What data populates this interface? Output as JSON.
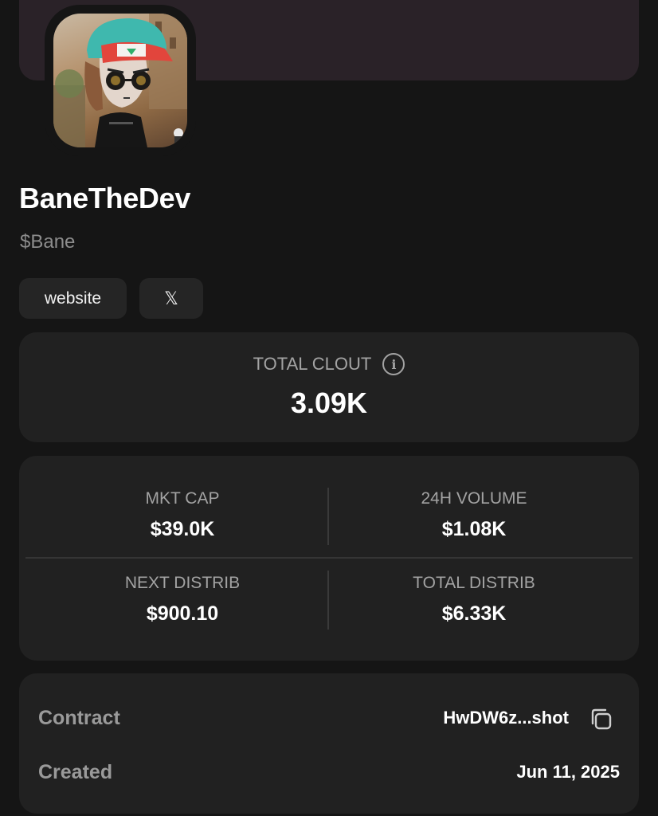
{
  "profile": {
    "name": "BaneTheDev",
    "ticker": "$Bane"
  },
  "links": {
    "website_label": "website",
    "x_label": "𝕏"
  },
  "clout": {
    "label": "TOTAL CLOUT",
    "value": "3.09K"
  },
  "stats": {
    "mkt_cap": {
      "label": "MKT CAP",
      "value": "$39.0K"
    },
    "volume_24h": {
      "label": "24H VOLUME",
      "value": "$1.08K"
    },
    "next_distrib": {
      "label": "NEXT DISTRIB",
      "value": "$900.10"
    },
    "total_distrib": {
      "label": "TOTAL DISTRIB",
      "value": "$6.33K"
    }
  },
  "details": {
    "contract_label": "Contract",
    "contract_value": "HwDW6z...shot",
    "created_label": "Created",
    "created_value": "Jun 11, 2025"
  },
  "icons": {
    "info": "info-icon",
    "copy": "copy-icon"
  }
}
